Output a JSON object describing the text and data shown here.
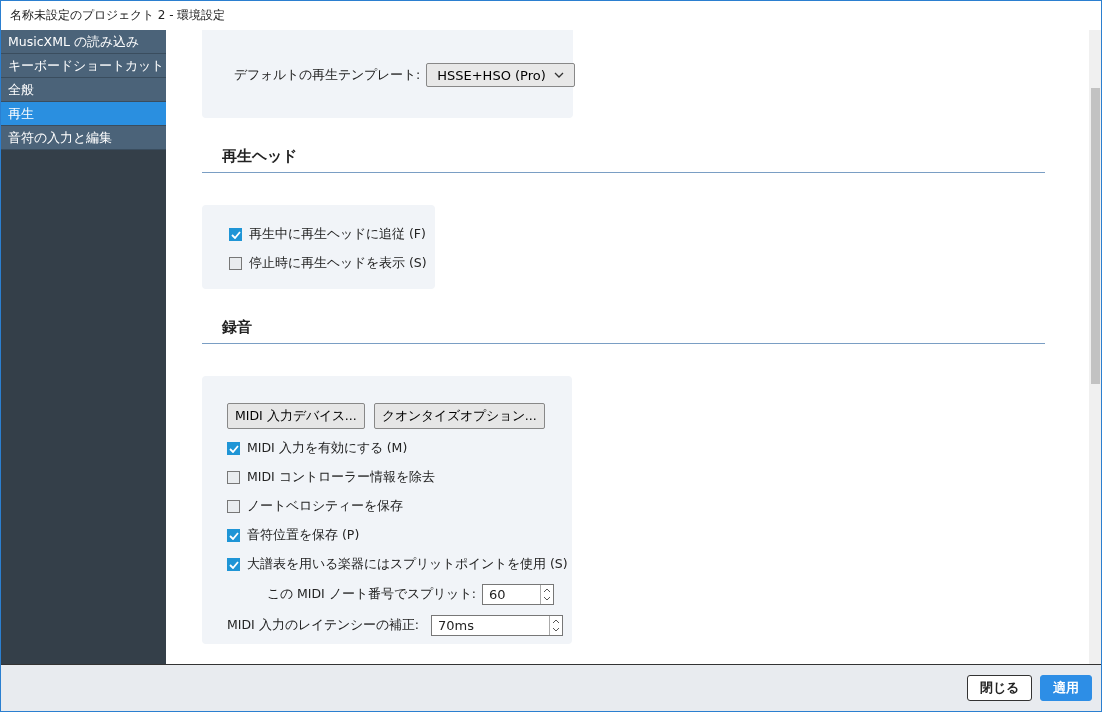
{
  "window": {
    "title": "名称未設定のプロジェクト 2 - 環境設定"
  },
  "sidebar": {
    "items": [
      {
        "label": "MusicXML の読み込み",
        "selected": false
      },
      {
        "label": "キーボードショートカット",
        "selected": false
      },
      {
        "label": "全般",
        "selected": false
      },
      {
        "label": "再生",
        "selected": true
      },
      {
        "label": "音符の入力と編集",
        "selected": false
      }
    ]
  },
  "template_setting": {
    "label": "デフォルトの再生テンプレート:",
    "value": "HSSE+HSO (Pro)"
  },
  "sections": [
    {
      "heading": "再生ヘッド",
      "options": [
        {
          "kind": "checkbox",
          "label": "再生中に再生ヘッドに追従 (F)",
          "checked": true
        },
        {
          "kind": "checkbox",
          "label": "停止時に再生ヘッドを表示 (S)",
          "checked": false
        }
      ]
    },
    {
      "heading": "録音",
      "buttons": [
        "MIDI 入力デバイス...",
        "クオンタイズオプション..."
      ],
      "options": [
        {
          "kind": "checkbox",
          "label": "MIDI 入力を有効にする (M)",
          "checked": true
        },
        {
          "kind": "checkbox",
          "label": "MIDI コントローラー情報を除去",
          "checked": false
        },
        {
          "kind": "checkbox",
          "label": "ノートベロシティーを保存",
          "checked": false
        },
        {
          "kind": "checkbox",
          "label": "音符位置を保存 (P)",
          "checked": true
        },
        {
          "kind": "checkbox",
          "label": "大譜表を用いる楽器にはスプリットポイントを使用 (S)",
          "checked": true,
          "children": [
            {
              "kind": "spin",
              "label": "この MIDI ノート番号でスプリット:",
              "value": "60"
            }
          ]
        },
        {
          "kind": "spin",
          "label": "MIDI 入力のレイテンシーの補正:",
          "value": "70ms"
        }
      ]
    }
  ],
  "footer": {
    "buttons": [
      {
        "label": "閉じる",
        "kind": "default"
      },
      {
        "label": "適用",
        "kind": "primary"
      }
    ]
  }
}
